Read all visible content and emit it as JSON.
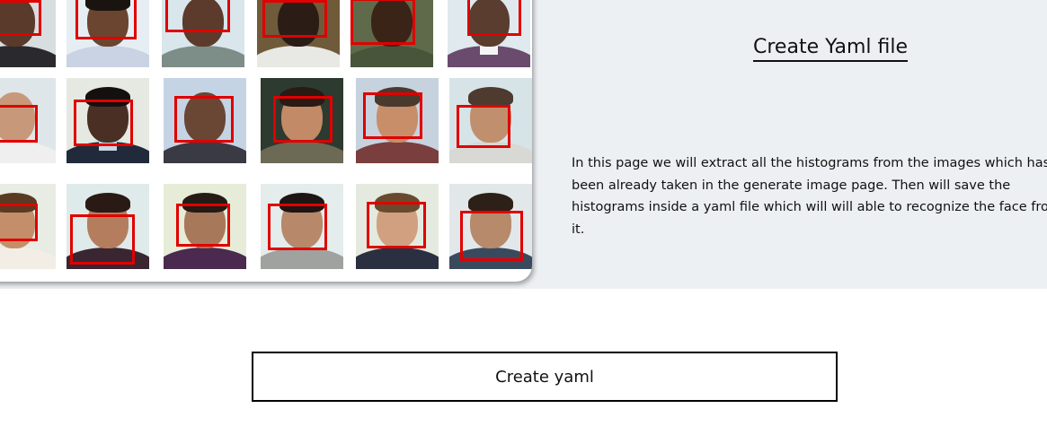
{
  "page": {
    "heading": "Create Yaml file",
    "description": "In this page we will extract all the histograms from the images which has been already taken in the generate image page. Then will save the histograms inside a yaml file which will will able to recognize the face from it."
  },
  "actions": {
    "create_button_label": "Create yaml"
  },
  "colors": {
    "band_background": "#edf0f3",
    "detection_box": "#e00000"
  }
}
